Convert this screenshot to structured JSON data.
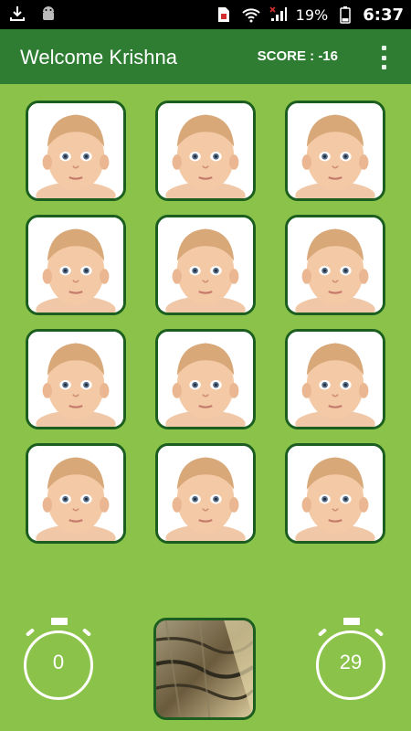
{
  "statusbar": {
    "battery_pct": "19%",
    "time": "6:37",
    "icons": [
      "download-icon",
      "android-icon",
      "sim-icon",
      "wifi-icon",
      "signal-icon",
      "battery-icon"
    ]
  },
  "appbar": {
    "title": "Welcome Krishna",
    "score": "SCORE : -16",
    "menu_icon": "overflow-menu-icon"
  },
  "board": {
    "rows": 4,
    "cols": 3,
    "card_image": "baby-face"
  },
  "footer": {
    "left_timer": "0",
    "right_timer": "29",
    "next_card_image": "tree-bark"
  },
  "colors": {
    "background": "#8bc34a",
    "appbar": "#2e7d32",
    "card_border": "#1b5e20"
  }
}
